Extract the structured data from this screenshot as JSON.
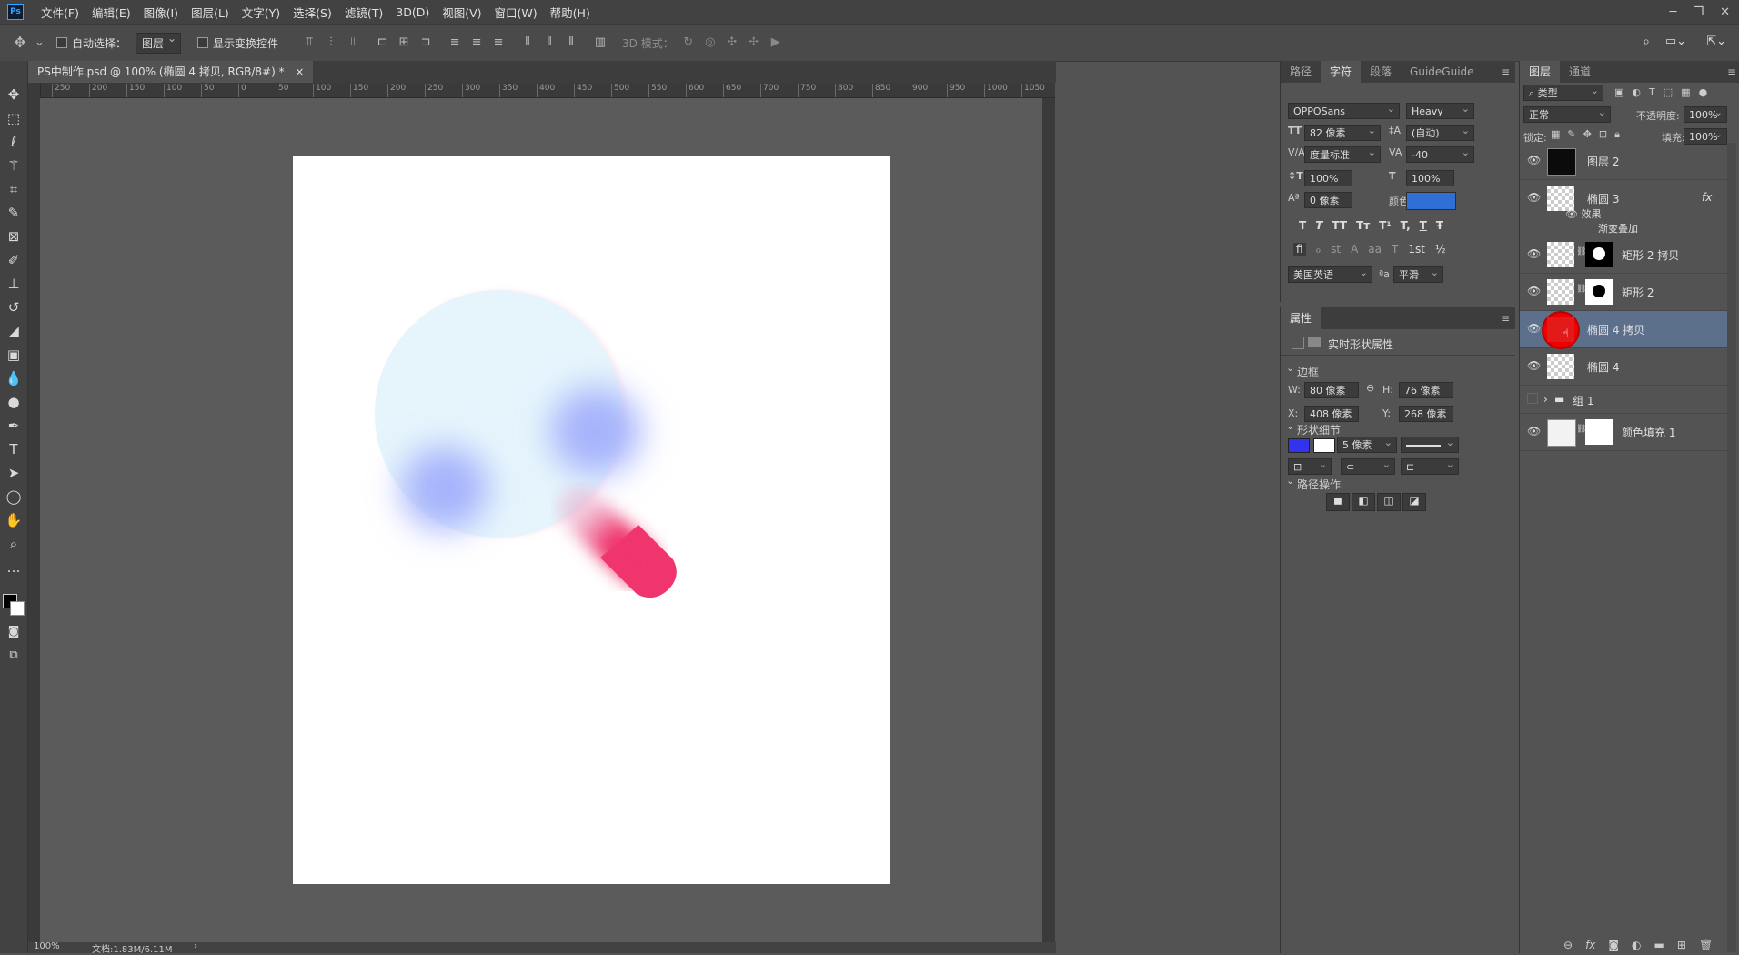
{
  "app": {
    "logo": "Ps"
  },
  "menu": [
    "文件(F)",
    "编辑(E)",
    "图像(I)",
    "图层(L)",
    "文字(Y)",
    "选择(S)",
    "滤镜(T)",
    "3D(D)",
    "视图(V)",
    "窗口(W)",
    "帮助(H)"
  ],
  "options": {
    "auto_select_label": "自动选择：",
    "auto_select_value": "图层",
    "show_transform_label": "显示变换控件",
    "mode_3d": "3D 模式："
  },
  "doc_tab": {
    "title": "PS中制作.psd @ 100% (椭圆 4 拷贝, RGB/8#) *",
    "close": "×"
  },
  "ruler_h": [
    "250",
    "200",
    "150",
    "100",
    "50",
    "0",
    "50",
    "100",
    "150",
    "200",
    "250",
    "300",
    "350",
    "400",
    "450",
    "500",
    "550",
    "600",
    "650",
    "700",
    "750",
    "800",
    "850",
    "900",
    "950",
    "1000",
    "1050",
    "1100"
  ],
  "status": {
    "zoom": "100%",
    "doc": "文档:1.83M/6.11M",
    "arrow": "›"
  },
  "character_panel": {
    "tabs": [
      "路径",
      "字符",
      "段落",
      "GuideGuide"
    ],
    "font_family": "OPPOSans",
    "font_style": "Heavy",
    "font_size": "82 像素",
    "leading": "(自动)",
    "kerning": "度量标准",
    "tracking": "-40",
    "vscale": "100%",
    "hscale": "100%",
    "baseline": "0 像素",
    "color_label": "颜色：",
    "color": "#2f6fd6",
    "style_buttons": [
      "T",
      "T",
      "TT",
      "Tт",
      "T¹",
      "T,",
      "T",
      "Ŧ"
    ],
    "ot_buttons": [
      "ﬁ",
      "ℴ",
      "st",
      "A",
      "aa",
      "T",
      "1st",
      "½"
    ],
    "language": "美国英语",
    "aa_label": "ªa",
    "antialias": "平滑"
  },
  "properties_panel": {
    "title": "属性",
    "subtitle": "实时形状属性",
    "bbox_label": "边框",
    "w_label": "W:",
    "w": "80 像素",
    "h_label": "H:",
    "h": "76 像素",
    "x_label": "X:",
    "x": "408 像素",
    "y_label": "Y:",
    "y": "268 像素",
    "shape_label": "形状细节",
    "stroke_width": "5 像素",
    "fill_color": "#3333ee",
    "path_ops_label": "路径操作"
  },
  "layers_panel": {
    "tabs": [
      "图层",
      "通道"
    ],
    "filter": "类型",
    "blend_mode": "正常",
    "opacity_label": "不透明度:",
    "opacity": "100%",
    "lock_label": "锁定:",
    "fill_label": "填充:",
    "fill": "100%",
    "layers": [
      {
        "name": "图层 2",
        "type": "black"
      },
      {
        "name": "椭圆 3",
        "type": "shape",
        "fx": "fx"
      },
      {
        "name": "效果",
        "type": "effect"
      },
      {
        "name": "渐变叠加",
        "type": "effect-item"
      },
      {
        "name": "矩形 2 拷贝",
        "type": "masked"
      },
      {
        "name": "矩形 2",
        "type": "masked"
      },
      {
        "name": "椭圆 4 拷贝",
        "type": "selected"
      },
      {
        "name": "椭圆 4",
        "type": "shape"
      },
      {
        "name": "组 1",
        "type": "group"
      },
      {
        "name": "颜色填充 1",
        "type": "fill"
      }
    ]
  },
  "artwork": {
    "circle_color": "#e6f5fc",
    "blob_color": "#a6b4fc",
    "handle_color": "#f0356d"
  }
}
